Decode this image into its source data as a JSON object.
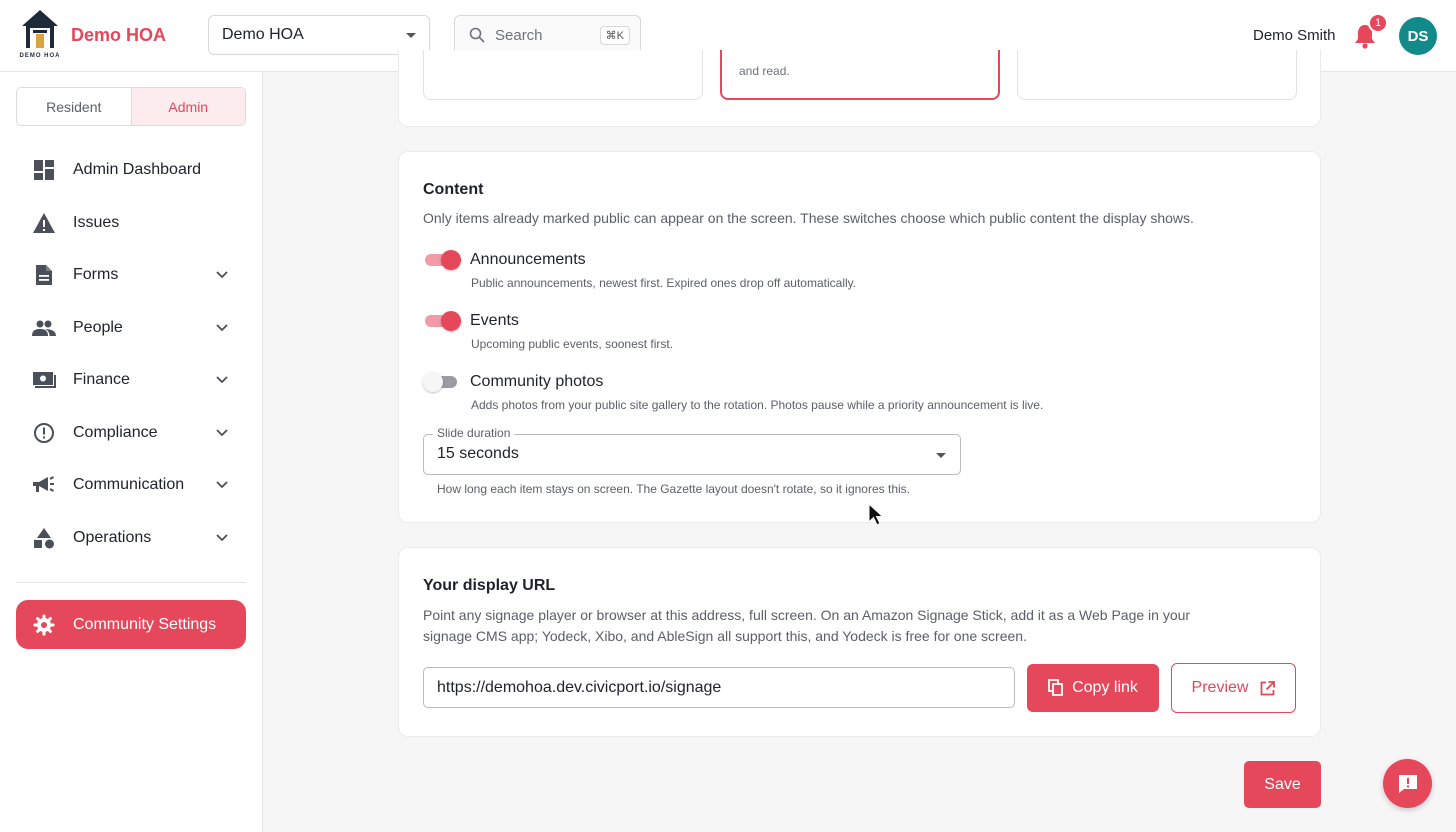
{
  "header": {
    "logo_text": "DEMO HOA",
    "brand": "Demo HOA",
    "org_select_value": "Demo HOA",
    "search_label": "Search",
    "search_shortcut": "⌘K",
    "user_name": "Demo Smith",
    "notification_count": "1",
    "avatar_initials": "DS"
  },
  "sidebar": {
    "role_resident": "Resident",
    "role_admin": "Admin",
    "items": [
      {
        "label": "Admin Dashboard",
        "icon": "dashboard-icon"
      },
      {
        "label": "Issues",
        "icon": "warning-icon"
      },
      {
        "label": "Forms",
        "icon": "document-icon"
      },
      {
        "label": "People",
        "icon": "people-icon"
      },
      {
        "label": "Finance",
        "icon": "money-icon"
      },
      {
        "label": "Compliance",
        "icon": "alert-circle-icon"
      },
      {
        "label": "Communication",
        "icon": "megaphone-icon"
      },
      {
        "label": "Operations",
        "icon": "shapes-icon"
      }
    ],
    "active_item": "Community Settings"
  },
  "layout_tiles": {
    "selected_tile_text": "and read."
  },
  "content": {
    "title": "Content",
    "description": "Only items already marked public can appear on the screen. These switches choose which public content the display shows.",
    "options": [
      {
        "label": "Announcements",
        "description": "Public announcements, newest first. Expired ones drop off automatically.",
        "enabled": true
      },
      {
        "label": "Events",
        "description": "Upcoming public events, soonest first.",
        "enabled": true
      },
      {
        "label": "Community photos",
        "description": "Adds photos from your public site gallery to the rotation. Photos pause while a priority announcement is live.",
        "enabled": false
      }
    ],
    "slide_duration_label": "Slide duration",
    "slide_duration_value": "15 seconds",
    "slide_duration_helper": "How long each item stays on screen. The Gazette layout doesn't rotate, so it ignores this."
  },
  "display_url": {
    "title": "Your display URL",
    "description_line1": "Point any signage player or browser at this address, full screen. On an Amazon Signage Stick, add it as a Web Page in your",
    "description_line2": "signage CMS app; Yodeck, Xibo, and AbleSign all support this, and Yodeck is free for one screen.",
    "url": "https://demohoa.dev.civicport.io/signage",
    "copy_label": "Copy link",
    "preview_label": "Preview"
  },
  "save_label": "Save",
  "colors": {
    "accent": "#e5485b",
    "avatar": "#138a8a"
  }
}
